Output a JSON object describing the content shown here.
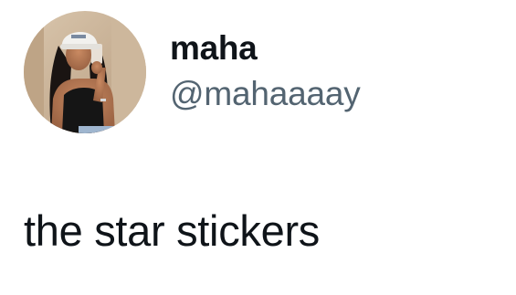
{
  "tweet": {
    "display_name": "maha",
    "handle": "@mahaaaay",
    "text": "the star stickers"
  },
  "colors": {
    "text_primary": "#0f1419",
    "text_secondary": "#536471",
    "background": "#ffffff"
  },
  "icons": {
    "avatar": "profile-photo"
  }
}
